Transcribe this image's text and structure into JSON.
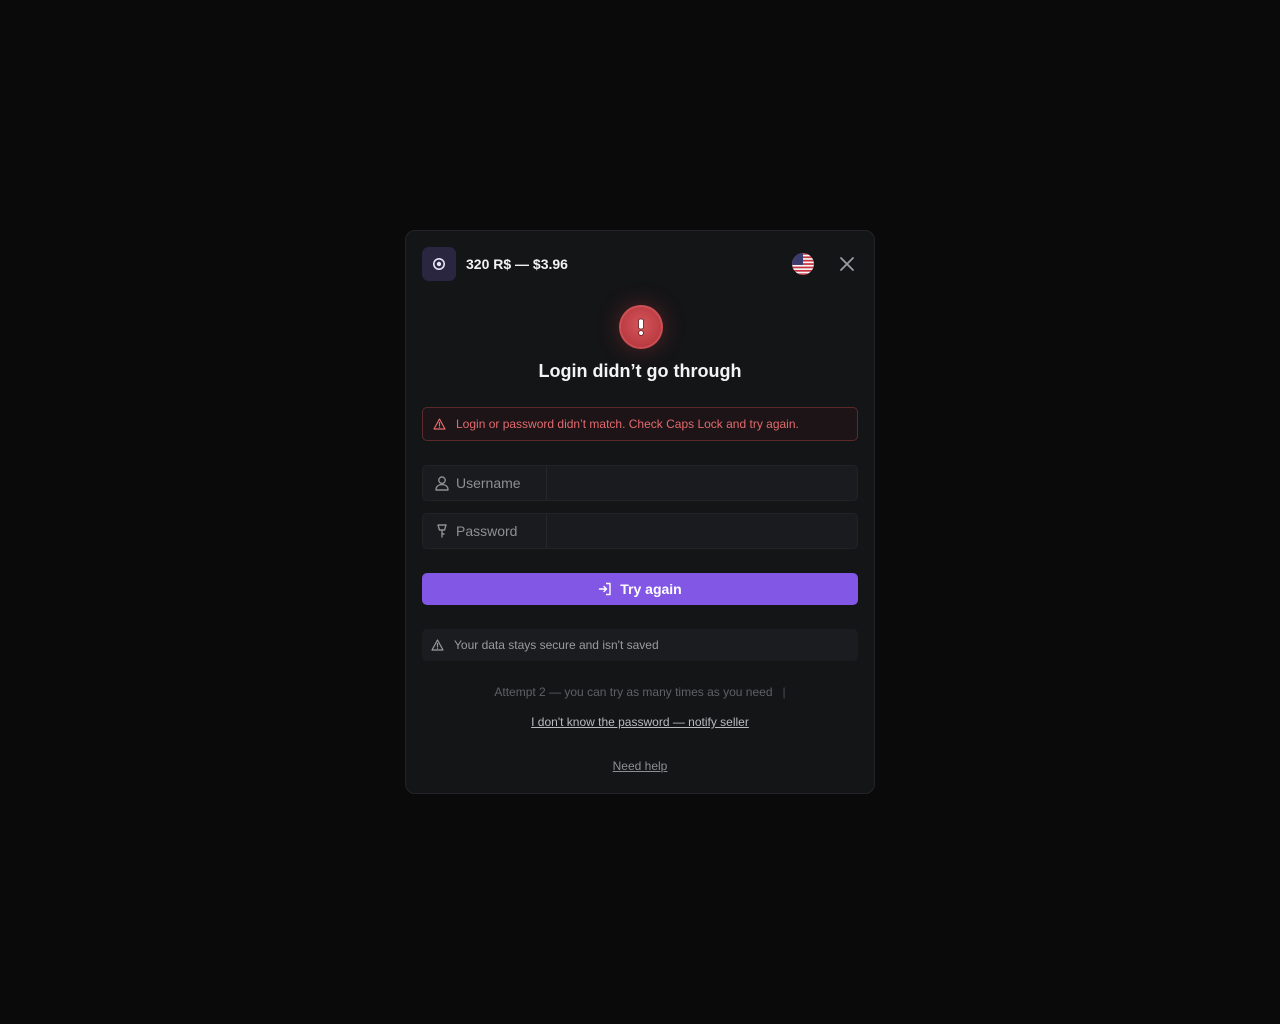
{
  "header": {
    "price": "320 R$ — $3.96",
    "app_icon": "robux-icon",
    "flag": "us-flag-icon",
    "close_icon": "close-icon"
  },
  "status": {
    "icon": "exclamation-icon",
    "title": "Login didn’t go through",
    "color": "#c0393f"
  },
  "alert": {
    "icon": "warning-triangle-icon",
    "message": "Login or password didn’t match. Check Caps Lock and try again.",
    "color": "#e26a6e"
  },
  "form": {
    "username": {
      "label": "Username",
      "value": "",
      "icon": "user-icon"
    },
    "password": {
      "label": "Password",
      "value": "",
      "icon": "key-icon"
    },
    "submit_label": "Try again",
    "submit_icon": "login-icon",
    "accent": "#8257e6"
  },
  "notice": {
    "icon": "warning-triangle-icon",
    "text": "Your data stays secure and isn't saved"
  },
  "footer": {
    "attempt_text": "Attempt 2 — you can try as many times as you need",
    "separator": "|",
    "notify_link": "I don't know the password — notify seller",
    "help_link": "Need help"
  }
}
